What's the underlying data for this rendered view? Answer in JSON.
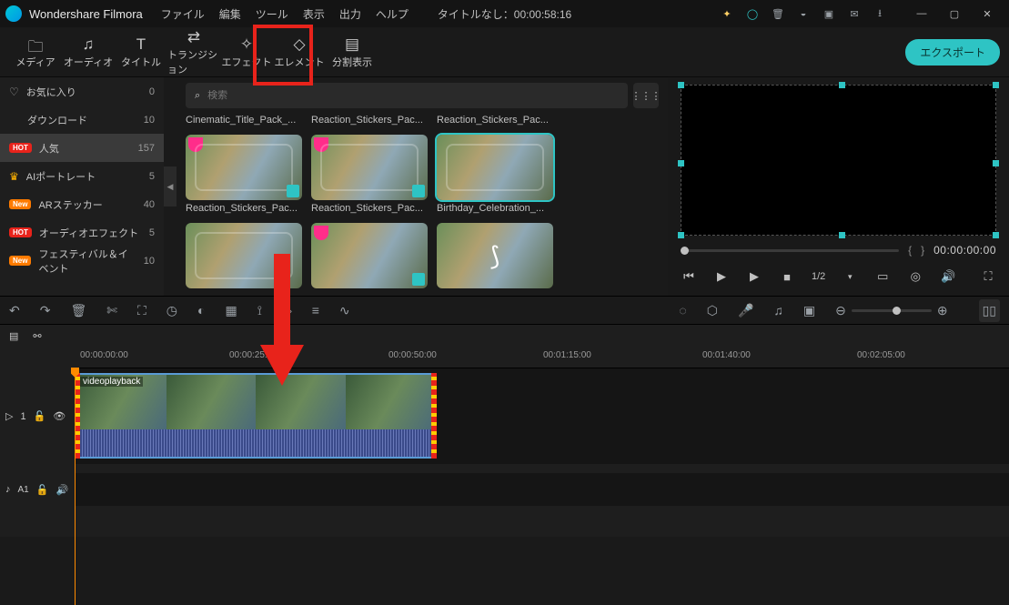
{
  "app": {
    "name": "Wondershare Filmora",
    "titleCenter": "タイトルなし：00:00:58:16"
  },
  "menus": [
    "ファイル",
    "編集",
    "ツール",
    "表示",
    "出力",
    "ヘルプ"
  ],
  "tabs": {
    "media": "メディア",
    "audio": "オーディオ",
    "title": "タイトル",
    "transition": "トランジション",
    "effect": "エフェクト",
    "element": "エレメント",
    "split": "分割表示"
  },
  "export": "エクスポート",
  "sidebar": [
    {
      "icon": "heart",
      "label": "お気に入り",
      "count": 0
    },
    {
      "icon": "",
      "label": "ダウンロード",
      "count": 10
    },
    {
      "icon": "hot",
      "label": "人気",
      "count": 157,
      "selected": true
    },
    {
      "icon": "crown",
      "label": "AIポートレート",
      "count": 5
    },
    {
      "icon": "new",
      "label": "ARステッカー",
      "count": 40
    },
    {
      "icon": "hot",
      "label": "オーディオエフェクト",
      "count": 5
    },
    {
      "icon": "new",
      "label": "フェスティバル＆イベント",
      "count": 10
    }
  ],
  "search": {
    "placeholder": "検索"
  },
  "items": [
    {
      "label": "Cinematic_Title_Pack_..."
    },
    {
      "label": "Reaction_Stickers_Pac..."
    },
    {
      "label": "Reaction_Stickers_Pac..."
    },
    {
      "label": "Reaction_Stickers_Pac..."
    },
    {
      "label": "Reaction_Stickers_Pac..."
    },
    {
      "label": "Birthday_Celebration_...",
      "selected": true
    },
    {
      "label": ""
    },
    {
      "label": ""
    },
    {
      "label": ""
    }
  ],
  "preview": {
    "timecode": "00:00:00:00",
    "braces1": "{",
    "braces2": "}",
    "fraction": "1/2"
  },
  "ruler": [
    "00:00:00:00",
    "00:00:25:00",
    "00:00:50:00",
    "00:01:15:00",
    "00:01:40:00",
    "00:02:05:00"
  ],
  "clip": {
    "name": "videoplayback"
  },
  "track": {
    "video": "1",
    "audio": "A1"
  }
}
